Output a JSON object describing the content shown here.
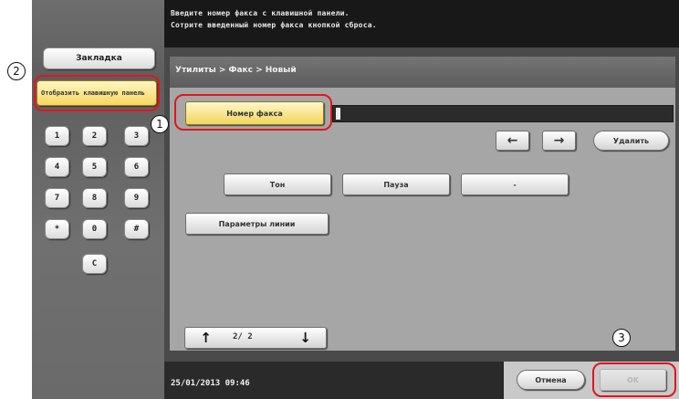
{
  "message": {
    "line1": "Введите номер факса с клавишной панели.",
    "line2": "Сотрите введенный номер факса кнопкой сброса."
  },
  "left_panel": {
    "bookmark_label": "Закладка",
    "keypad_display_label": "Отобразить клавишную панель",
    "keypad": [
      "1",
      "2",
      "3",
      "4",
      "5",
      "6",
      "7",
      "8",
      "9",
      "*",
      "0",
      "#",
      "C"
    ]
  },
  "breadcrumb": "Утилиты > Факс > Новый",
  "fax_number_label": "Номер факса",
  "fax_number_value": "",
  "nav": {
    "left_arrow": "←",
    "right_arrow": "→",
    "delete_label": "Удалить"
  },
  "special_buttons": {
    "tone": "Тон",
    "pause": "Пауза",
    "dash": "-"
  },
  "line_params_label": "Параметры линии",
  "pager": {
    "up": "↑",
    "down": "↓",
    "counter": "2/ 2"
  },
  "footer": {
    "datetime": "25/01/2013   09:46",
    "cancel_label": "Отмена",
    "ok_label": "OK"
  },
  "callouts": [
    "1",
    "2",
    "3"
  ],
  "colors": {
    "highlight": "#f1d55c",
    "callout": "#e0161b"
  }
}
